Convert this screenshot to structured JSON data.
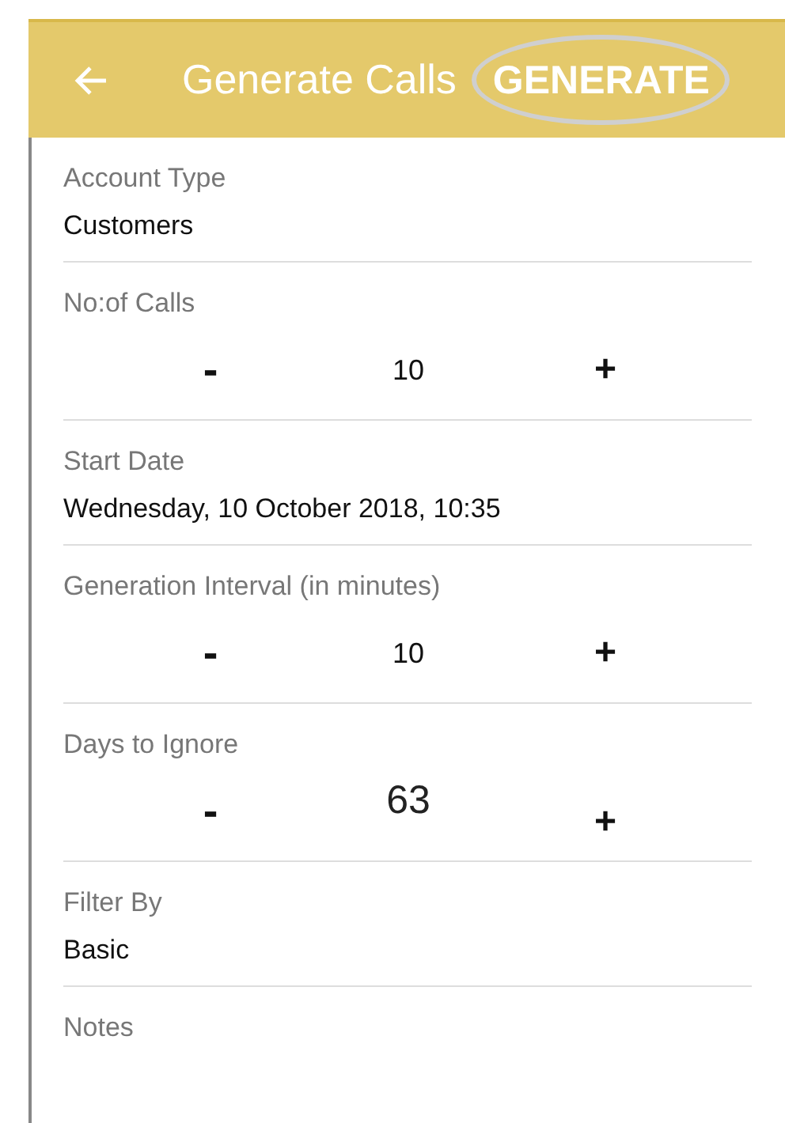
{
  "app_bar": {
    "title": "Generate Calls",
    "action": "GENERATE"
  },
  "fields": [
    {
      "kind": "text",
      "label": "Account Type",
      "value": "Customers"
    },
    {
      "kind": "stepper",
      "label": "No:of Calls",
      "minus": "-",
      "value": "10",
      "plus": "+",
      "large": false
    },
    {
      "kind": "text",
      "label": "Start Date",
      "value": "Wednesday, 10 October 2018, 10:35"
    },
    {
      "kind": "stepper",
      "label": "Generation Interval (in minutes)",
      "minus": "-",
      "value": "10",
      "plus": "+",
      "large": false
    },
    {
      "kind": "stepper",
      "label": "Days to Ignore",
      "minus": "-",
      "value": "63",
      "plus": "+",
      "large": true
    },
    {
      "kind": "text",
      "label": "Filter By",
      "value": "Basic"
    },
    {
      "kind": "label",
      "label": "Notes"
    }
  ]
}
